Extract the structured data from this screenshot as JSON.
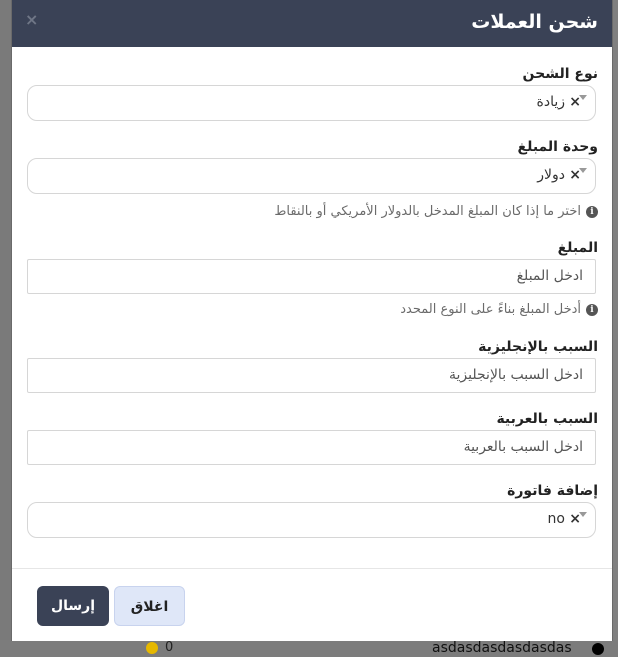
{
  "modal": {
    "title": "شحن العملات",
    "close_symbol": "×",
    "fields": {
      "charge_type": {
        "label": "نوع الشحن",
        "value": "زيادة",
        "clear": "×"
      },
      "amount_unit": {
        "label": "وحدة المبلغ",
        "value": "دولار",
        "clear": "×",
        "hint": "اختر ما إذا كان المبلغ المدخل بالدولار الأمريكي أو بالنقاط"
      },
      "amount": {
        "label": "المبلغ",
        "placeholder": "ادخل المبلغ",
        "hint": "أدخل المبلغ بناءً على النوع المحدد"
      },
      "reason_en": {
        "label": "السبب بالإنجليزية",
        "placeholder": "ادخل السبب بالإنجليزية"
      },
      "reason_ar": {
        "label": "السبب بالعربية",
        "placeholder": "ادخل السبب بالعربية"
      },
      "add_invoice": {
        "label": "إضافة فاتورة",
        "value": "no",
        "clear": "×"
      }
    },
    "buttons": {
      "submit": "إرسال",
      "close": "اغلاق"
    }
  },
  "background": {
    "row_count": "0",
    "row_name": "asdasdasdasdasdas"
  },
  "colors": {
    "header": "#3a4256",
    "close_button_bg": "#dfe7f8"
  }
}
